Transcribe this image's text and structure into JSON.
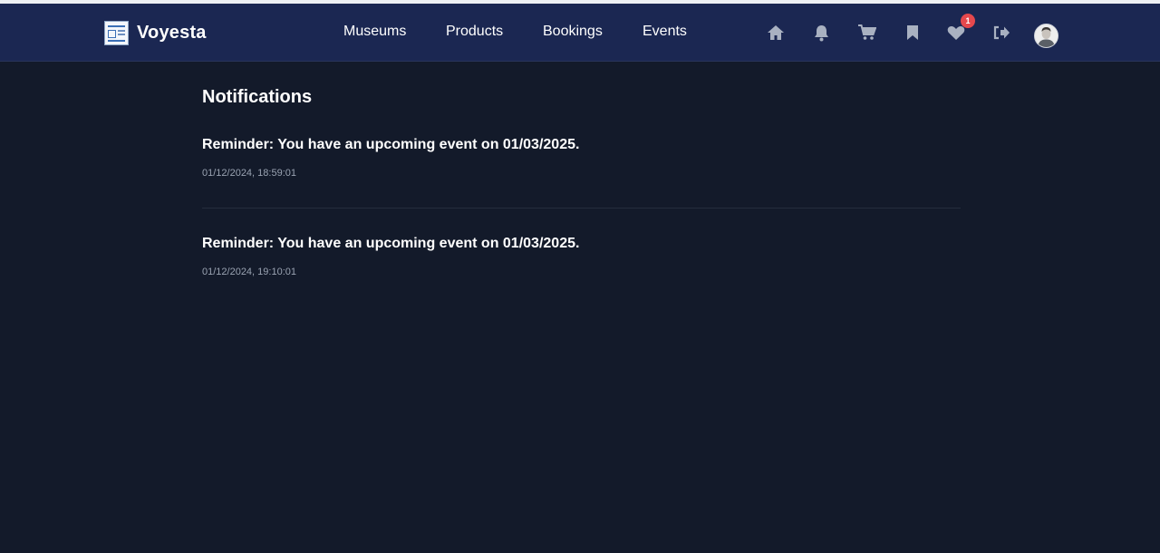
{
  "brand": {
    "name": "Voyesta"
  },
  "nav": {
    "links": [
      {
        "label": "Museums"
      },
      {
        "label": "Products"
      },
      {
        "label": "Bookings"
      },
      {
        "label": "Events"
      }
    ],
    "icons": [
      "home-icon",
      "bell-icon",
      "cart-icon",
      "bookmark-icon",
      "heart-icon",
      "logout-icon"
    ],
    "wishlist_badge": "1"
  },
  "colors": {
    "navbar": "#1b2752",
    "background": "#131a2a",
    "icon": "#a9b1c1",
    "badge": "#e5484d"
  },
  "page": {
    "title": "Notifications"
  },
  "notifications": [
    {
      "message": "Reminder: You have an upcoming event on 01/03/2025.",
      "timestamp": "01/12/2024, 18:59:01"
    },
    {
      "message": "Reminder: You have an upcoming event on 01/03/2025.",
      "timestamp": "01/12/2024, 19:10:01"
    }
  ]
}
